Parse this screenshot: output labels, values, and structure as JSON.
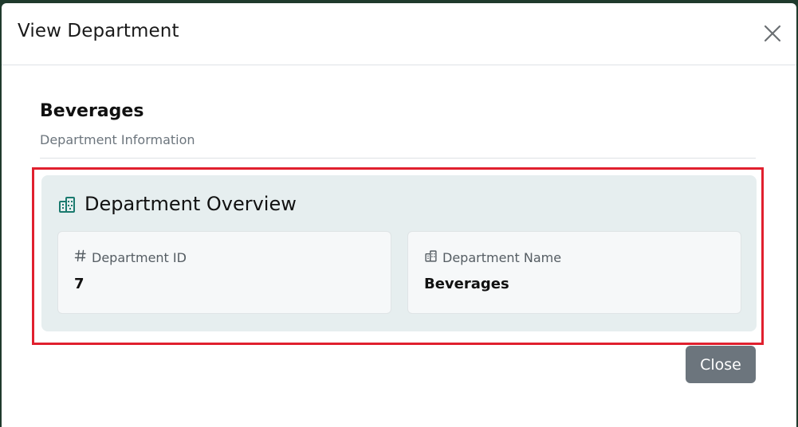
{
  "modal": {
    "title": "View Department",
    "close_icon": "close-x-icon"
  },
  "department": {
    "name": "Beverages",
    "subtitle": "Department Information"
  },
  "overview": {
    "title": "Department Overview",
    "icon": "building-icon",
    "accent_color": "#1a7a6e",
    "fields": [
      {
        "label": "Department ID",
        "icon": "hash-icon",
        "value": "7"
      },
      {
        "label": "Department Name",
        "icon": "building-icon",
        "value": "Beverages"
      }
    ]
  },
  "footer": {
    "close_label": "Close"
  },
  "colors": {
    "highlight": "#e0202e",
    "overview_bg": "#e6eeef",
    "button_bg": "#6c757d"
  }
}
